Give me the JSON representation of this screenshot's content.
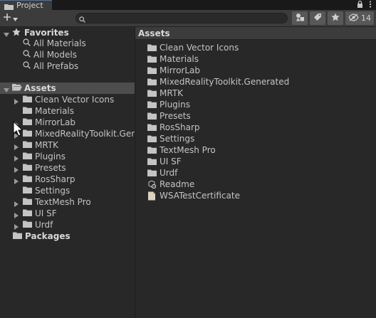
{
  "tab": {
    "title": "Project"
  },
  "toolbar": {
    "hidden_count": "14"
  },
  "favorites": {
    "header": "Favorites",
    "items": [
      {
        "label": "All Materials"
      },
      {
        "label": "All Models"
      },
      {
        "label": "All Prefabs"
      }
    ]
  },
  "assets_tree": {
    "header": "Assets",
    "items": [
      {
        "label": "Clean Vector Icons",
        "expandable": true
      },
      {
        "label": "Materials",
        "expandable": false
      },
      {
        "label": "MirrorLab",
        "expandable": true
      },
      {
        "label": "MixedRealityToolkit.Generated",
        "expandable": true
      },
      {
        "label": "MRTK",
        "expandable": true
      },
      {
        "label": "Plugins",
        "expandable": true
      },
      {
        "label": "Presets",
        "expandable": true
      },
      {
        "label": "RosSharp",
        "expandable": true
      },
      {
        "label": "Settings",
        "expandable": false
      },
      {
        "label": "TextMesh Pro",
        "expandable": true
      },
      {
        "label": "UI SF",
        "expandable": true
      },
      {
        "label": "Urdf",
        "expandable": true
      }
    ]
  },
  "packages": {
    "header": "Packages"
  },
  "content": {
    "breadcrumb": "Assets",
    "items": [
      {
        "label": "Clean Vector Icons",
        "icon": "folder-icon"
      },
      {
        "label": "Materials",
        "icon": "folder-icon"
      },
      {
        "label": "MirrorLab",
        "icon": "folder-icon"
      },
      {
        "label": "MixedRealityToolkit.Generated",
        "icon": "folder-icon"
      },
      {
        "label": "MRTK",
        "icon": "folder-icon"
      },
      {
        "label": "Plugins",
        "icon": "folder-icon"
      },
      {
        "label": "Presets",
        "icon": "folder-icon"
      },
      {
        "label": "RosSharp",
        "icon": "folder-icon"
      },
      {
        "label": "Settings",
        "icon": "folder-icon"
      },
      {
        "label": "TextMesh Pro",
        "icon": "folder-icon"
      },
      {
        "label": "UI SF",
        "icon": "folder-icon"
      },
      {
        "label": "Urdf",
        "icon": "folder-icon"
      },
      {
        "label": "Readme",
        "icon": "readme-asset-icon"
      },
      {
        "label": "WSATestCertificate",
        "icon": "certificate-file-icon"
      }
    ]
  },
  "colors": {
    "accent": "#3a79bb",
    "panel": "#282828",
    "toolbar": "#3c3c3c",
    "selection": "#4d4d4d"
  }
}
